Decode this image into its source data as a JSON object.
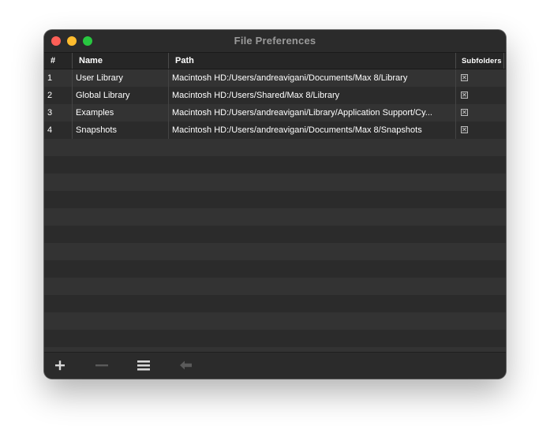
{
  "window": {
    "title": "File Preferences"
  },
  "table": {
    "columns": [
      "#",
      "Name",
      "Path",
      "Subfolders"
    ],
    "rows": [
      {
        "num": "1",
        "name": "User Library",
        "path": "Macintosh HD:/Users/andreavigani/Documents/Max 8/Library",
        "subfolders": true
      },
      {
        "num": "2",
        "name": "Global Library",
        "path": "Macintosh HD:/Users/Shared/Max 8/Library",
        "subfolders": true
      },
      {
        "num": "3",
        "name": "Examples",
        "path": "Macintosh HD:/Users/andreavigani/Library/Application Support/Cy...",
        "subfolders": true
      },
      {
        "num": "4",
        "name": "Snapshots",
        "path": "Macintosh HD:/Users/andreavigani/Documents/Max 8/Snapshots",
        "subfolders": true
      }
    ]
  },
  "toolbar": {
    "add_icon": "plus-icon",
    "remove_icon": "minus-icon",
    "menu_icon": "list-icon",
    "reveal_icon": "arrow-left-icon"
  },
  "colors": {
    "window_bg": "#2d2d2d",
    "close": "#fe5f57",
    "minimize": "#febc2e",
    "maximize": "#28c840",
    "disabled_icon": "#5a5a5a",
    "enabled_icon": "#d8d8d8"
  }
}
